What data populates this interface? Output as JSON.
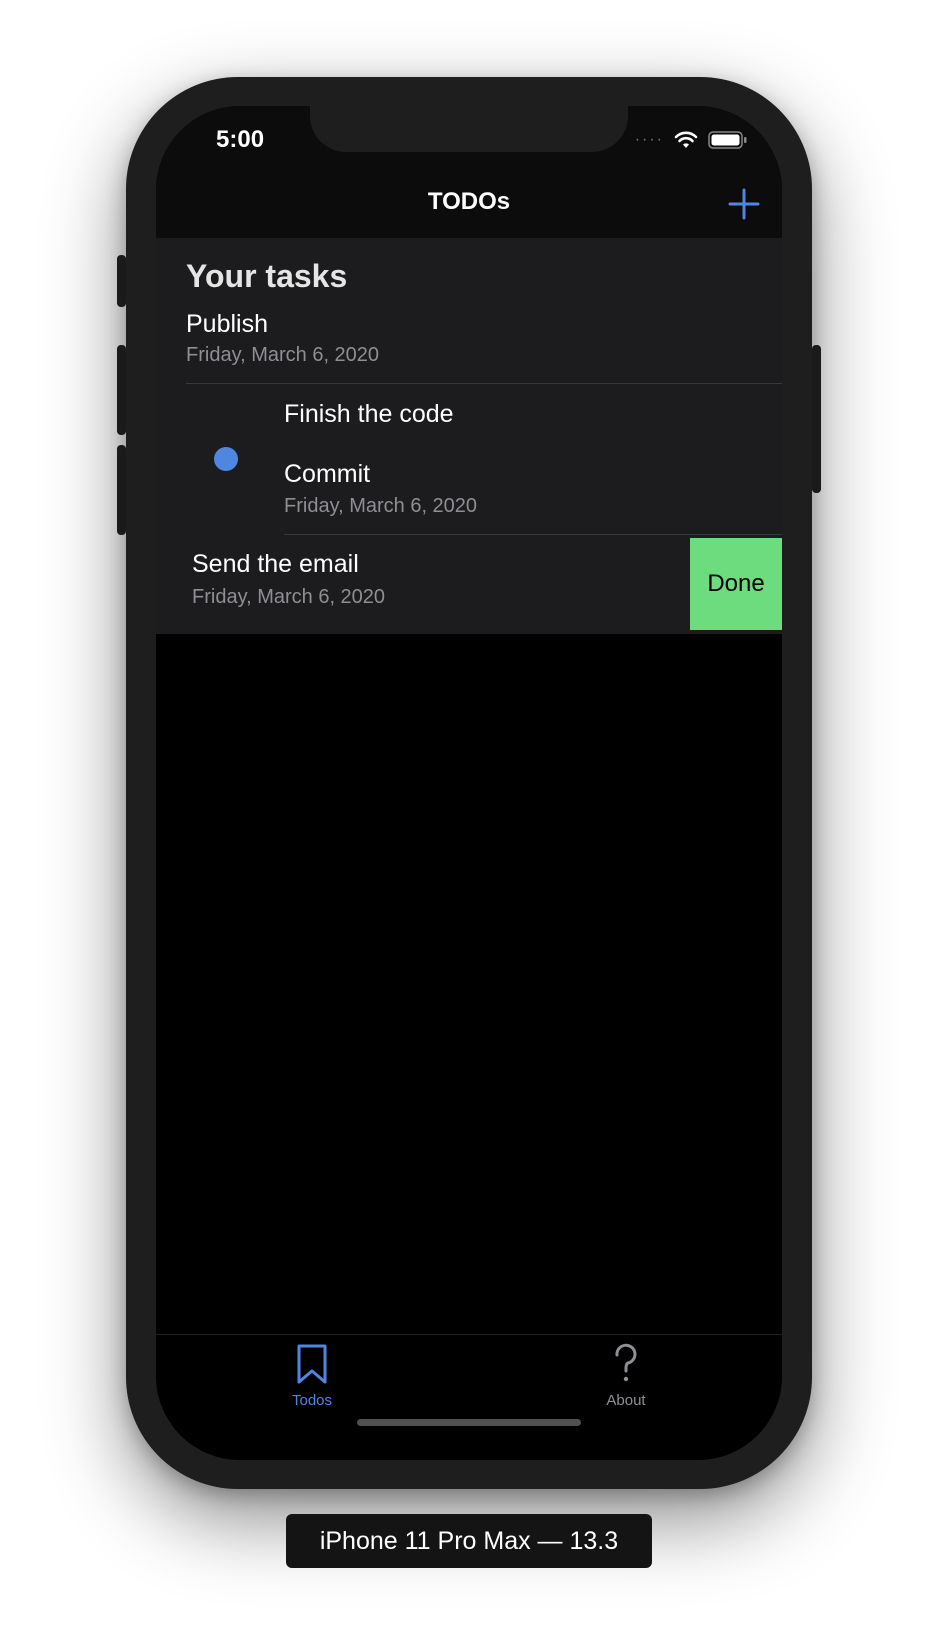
{
  "status_bar": {
    "time": "5:00",
    "signal": "····"
  },
  "nav": {
    "title": "TODOs",
    "add_icon": "plus-icon"
  },
  "list": {
    "section_title": "Your tasks",
    "items": [
      {
        "title": "Publish",
        "date": "Friday, March 6, 2020"
      },
      {
        "title": "Finish the code"
      },
      {
        "title": "Commit",
        "date": "Friday, March 6, 2020"
      },
      {
        "title": "Send the email",
        "date": "Friday, March 6, 2020"
      }
    ],
    "swipe_action": "Done"
  },
  "tabs": [
    {
      "label": "Todos",
      "icon": "bookmark-icon",
      "selected": true
    },
    {
      "label": "About",
      "icon": "question-mark-icon",
      "selected": false
    }
  ],
  "device_label": "iPhone 11 Pro Max — 13.3",
  "colors": {
    "accent": "#4f86e0",
    "done": "#6ddc7f",
    "row_bg": "#1c1c1e",
    "secondary_text": "#8e8e93"
  }
}
